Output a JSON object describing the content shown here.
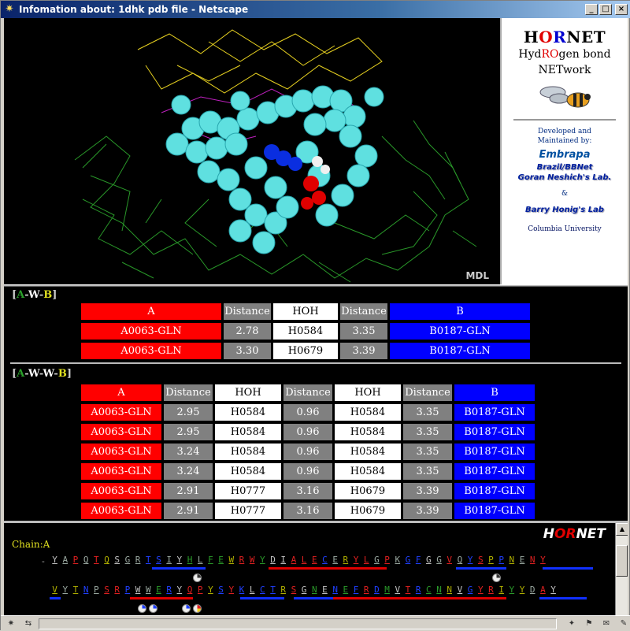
{
  "window": {
    "title": "Infomation about: 1dhk pdb file - Netscape",
    "btn_min": "_",
    "btn_max": "□",
    "btn_close": "×"
  },
  "viewer": {
    "label": "MDL"
  },
  "sidebar": {
    "brand_h": "H",
    "brand_o": "O",
    "brand_r": "R",
    "brand_net": "NET",
    "sub1_a": "Hyd",
    "sub1_b": "RO",
    "sub1_c": "gen bond",
    "sub2_a": "NET",
    "sub2_b": "work",
    "developed": "Developed and",
    "maintained": "Maintained by:",
    "embrapa": "Embrapa",
    "brazil": "Brazil/BBNet",
    "goran": "Goran Neshich's Lab.",
    "amp": "&",
    "barry": "Barry Honig's Lab",
    "columbia": "Columbia University"
  },
  "awb": {
    "label_a": "A",
    "label_w": "W",
    "label_b": "B",
    "headers": [
      "A",
      "Distance",
      "HOH",
      "Distance",
      "B"
    ],
    "rows": [
      [
        "A0063-GLN",
        "2.78",
        "H0584",
        "3.35",
        "B0187-GLN"
      ],
      [
        "A0063-GLN",
        "3.30",
        "H0679",
        "3.39",
        "B0187-GLN"
      ]
    ]
  },
  "awwb": {
    "label_a": "A",
    "label_w1": "W",
    "label_w2": "W",
    "label_b": "B",
    "headers": [
      "A",
      "Distance",
      "HOH",
      "Distance",
      "HOH",
      "Distance",
      "B"
    ],
    "rows": [
      [
        "A0063-GLN",
        "2.95",
        "H0584",
        "0.96",
        "H0584",
        "3.35",
        "B0187-GLN"
      ],
      [
        "A0063-GLN",
        "2.95",
        "H0584",
        "0.96",
        "H0584",
        "3.35",
        "B0187-GLN"
      ],
      [
        "A0063-GLN",
        "3.24",
        "H0584",
        "0.96",
        "H0584",
        "3.35",
        "B0187-GLN"
      ],
      [
        "A0063-GLN",
        "3.24",
        "H0584",
        "0.96",
        "H0584",
        "3.35",
        "B0187-GLN"
      ],
      [
        "A0063-GLN",
        "2.91",
        "H0777",
        "3.16",
        "H0679",
        "3.39",
        "B0187-GLN"
      ],
      [
        "A0063-GLN",
        "2.91",
        "H0777",
        "3.16",
        "H0679",
        "3.39",
        "B0187-GLN"
      ]
    ]
  },
  "bottom": {
    "logo_h": "H",
    "logo_o": "O",
    "logo_r": "R",
    "logo_net": "NET",
    "chain_label": "Chain:A",
    "dash": "-",
    "seq1": [
      "Y",
      "A",
      "P",
      "Q",
      "T",
      "Q",
      "S",
      "G",
      "R",
      "T",
      "S",
      "I",
      "Y",
      "H",
      "L",
      "F",
      "E",
      "W",
      "R",
      "W",
      "Y",
      "D",
      "I",
      "A",
      "L",
      "E",
      "C",
      "E",
      "R",
      "Y",
      "L",
      "G",
      "P",
      "K",
      "G",
      "F",
      "G",
      "G",
      "V",
      "Q",
      "Y",
      "S",
      "P",
      "P",
      "N",
      "E",
      "N",
      "Y"
    ],
    "seq2": [
      "V",
      "Y",
      "T",
      "N",
      "P",
      "S",
      "R",
      "P",
      "W",
      "W",
      "E",
      "R",
      "Y",
      "Q",
      "P",
      "Y",
      "S",
      "Y",
      "K",
      "L",
      "C",
      "T",
      "R",
      "S",
      "G",
      "N",
      "E",
      "N",
      "E",
      "F",
      "R",
      "D",
      "M",
      "V",
      "T",
      "R",
      "C",
      "N",
      "N",
      "V",
      "G",
      "Y",
      "R",
      "I",
      "Y",
      "Y",
      "D",
      "A",
      "Y"
    ]
  },
  "colors": {
    "accent_red": "#ff0000",
    "accent_blue": "#0000ff",
    "cell_gray": "#808080"
  },
  "status_icons": [
    "netscape-icon",
    "connection-icon",
    "security-icon",
    "navigator-icon",
    "mail-icon",
    "composer-icon"
  ]
}
